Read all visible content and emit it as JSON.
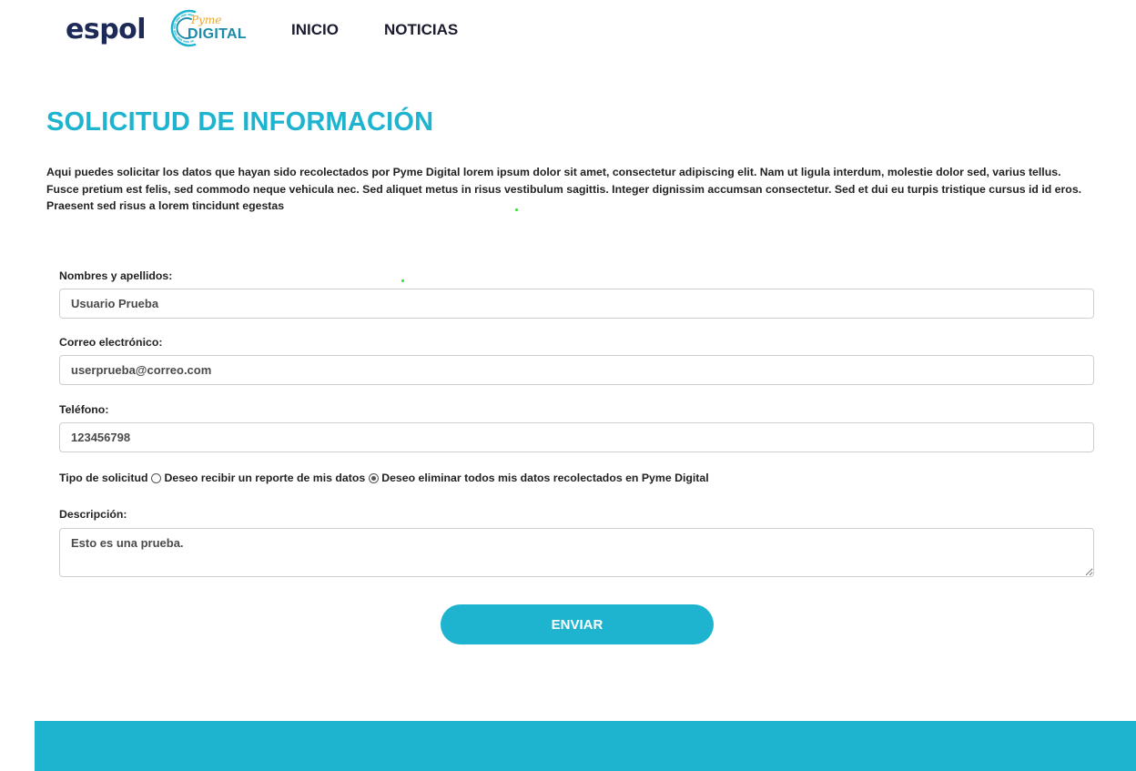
{
  "header": {
    "logo_espol": "espol",
    "logo_pyme_script": "Pyme",
    "logo_pyme_digital": "DIGITAL",
    "nav": [
      {
        "label": "INICIO"
      },
      {
        "label": "NOTICIAS"
      }
    ]
  },
  "main": {
    "title": "SOLICITUD DE INFORMACIÓN",
    "intro": "Aqui puedes solicitar los datos que hayan sido recolectados por Pyme Digital lorem ipsum dolor sit amet, consectetur adipiscing elit. Nam ut ligula interdum, molestie dolor sed, varius tellus. Fusce pretium est felis, sed commodo neque vehicula nec. Sed aliquet metus in risus vestibulum sagittis. Integer dignissim accumsan consectetur. Sed et dui eu turpis tristique cursus id id eros. Praesent sed risus a lorem tincidunt egestas"
  },
  "form": {
    "name_label": "Nombres y apellidos:",
    "name_value": "Usuario Prueba",
    "email_label": "Correo electrónico:",
    "email_value": "userprueba@correo.com",
    "phone_label": "Teléfono:",
    "phone_value": "123456798",
    "request_type_label": "Tipo de solicitud",
    "options": [
      {
        "label": "Deseo recibir un reporte de mis datos",
        "checked": false
      },
      {
        "label": "Deseo eliminar todos mis datos recolectados en Pyme Digital",
        "checked": true
      }
    ],
    "description_label": "Descripción:",
    "description_value": "Esto es una prueba.",
    "submit_label": "ENVIAR"
  },
  "colors": {
    "accent": "#1eb4d0",
    "brand_dark": "#1d2a57",
    "logo_gold": "#e8a630"
  }
}
